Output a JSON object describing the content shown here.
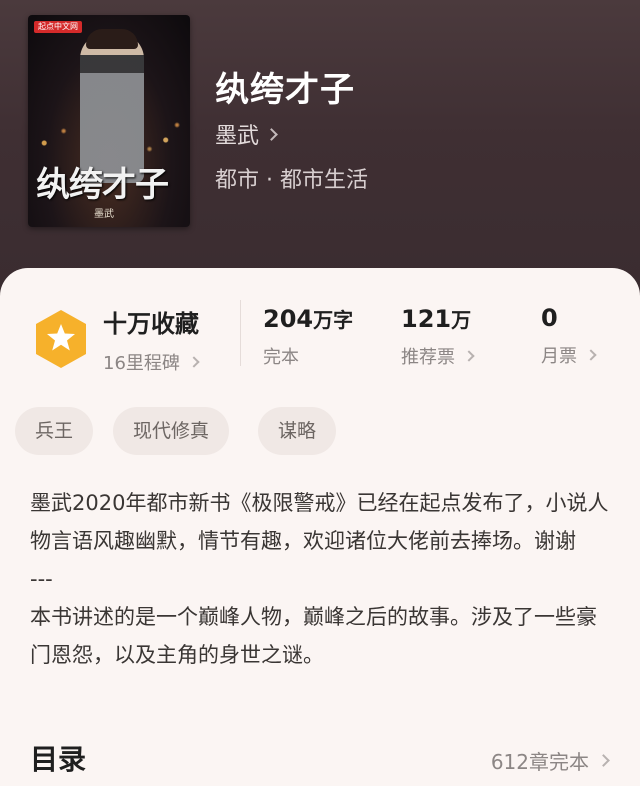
{
  "book": {
    "title": "纨绔才子",
    "author": "墨武",
    "genre": "都市 · 都市生活",
    "cover": {
      "logo": "起点中文网",
      "title": "纨绔才子",
      "author": "墨武"
    }
  },
  "stats": {
    "collection": {
      "main": "十万收藏",
      "sub": "16里程碑"
    },
    "words": {
      "value": "204",
      "unit": "万字",
      "sub": "完本"
    },
    "recommend": {
      "value": "121",
      "unit": "万",
      "sub": "推荐票"
    },
    "monthly": {
      "value": "0",
      "sub": "月票"
    }
  },
  "tags": [
    "兵王",
    "现代修真",
    "谋略"
  ],
  "description": [
    "墨武2020年都市新书《极限警戒》已经在起点发布了，小说人物言语风趣幽默，情节有趣，欢迎诸位大佬前去捧场。谢谢",
    "---",
    "本书讲述的是一个巅峰人物，巅峰之后的故事。涉及了一些豪门恩怨，以及主角的身世之谜。"
  ],
  "toc": {
    "title": "目录",
    "info": "612章完本"
  },
  "colors": {
    "badge": "#f6b12b",
    "header_bg": "#3f2f33",
    "card_bg": "#fbf5f3"
  }
}
